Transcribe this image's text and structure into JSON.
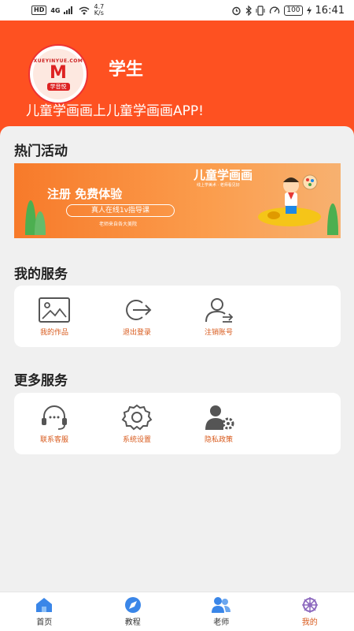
{
  "status_bar": {
    "hd": "HD",
    "signal": "4G",
    "speed_value": "4.7",
    "speed_unit": "K/s",
    "battery": "100",
    "time": "16:41"
  },
  "header": {
    "logo_top": "XUEYINYUE.COM",
    "logo_mark": "M",
    "logo_bottom": "学音悦",
    "username": "学生",
    "slogan": "儿童学画画上儿童学画画APP!"
  },
  "hot": {
    "title": "热门活动",
    "banner": {
      "title": "儿童学画画",
      "subtitle": "线上学美术 · 老师看见好",
      "main": "注册 免费体验",
      "pill": "真人在线1v指导课",
      "footnote": "老师来自各大美院"
    }
  },
  "my_services": {
    "title": "我的服务",
    "items": [
      {
        "label": "我的作品",
        "icon": "picture-icon"
      },
      {
        "label": "退出登录",
        "icon": "logout-icon"
      },
      {
        "label": "注销账号",
        "icon": "cancel-account-icon"
      }
    ]
  },
  "more_services": {
    "title": "更多服务",
    "items": [
      {
        "label": "联系客服",
        "icon": "headset-icon"
      },
      {
        "label": "系统设置",
        "icon": "gear-icon"
      },
      {
        "label": "隐私政策",
        "icon": "privacy-icon"
      }
    ]
  },
  "tabbar": {
    "items": [
      {
        "label": "首页",
        "icon": "home-icon"
      },
      {
        "label": "教程",
        "icon": "compass-icon"
      },
      {
        "label": "老师",
        "icon": "teachers-icon"
      },
      {
        "label": "我的",
        "icon": "profile-wheel-icon"
      }
    ],
    "active_index": 3
  },
  "colors": {
    "header_bg": "#fe5121",
    "accent": "#d85a1c",
    "icon_gray": "#555555",
    "tab_blue": "#3a86e8"
  }
}
